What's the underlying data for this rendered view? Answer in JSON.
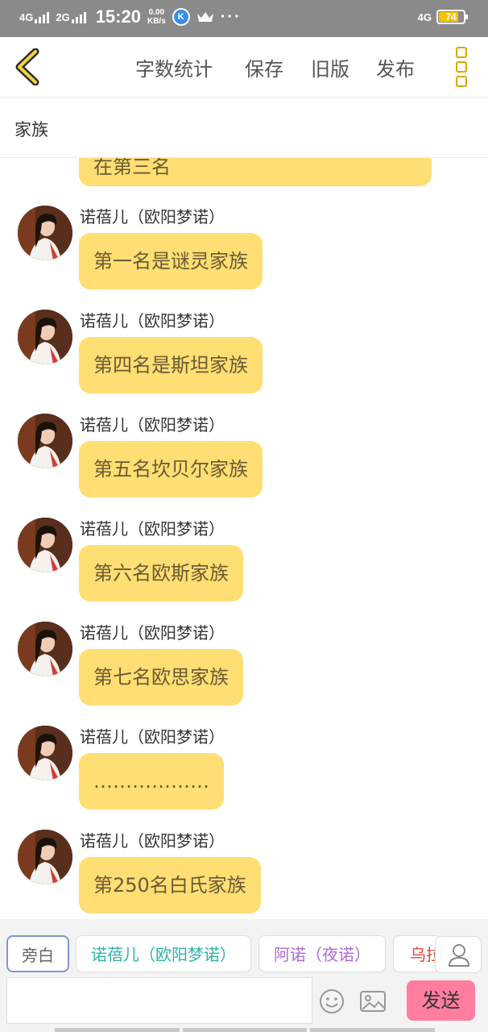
{
  "status_bar": {
    "signal_1": "4G",
    "signal_2": "2G",
    "time": "15:20",
    "speed_value": "0.00",
    "speed_unit": "KB/s",
    "k_icon": "K",
    "dots": "···",
    "network_right": "4G",
    "battery": "74"
  },
  "toolbar": {
    "word_count": "字数统计",
    "save": "保存",
    "old_version": "旧版",
    "publish": "发布"
  },
  "title": "家族",
  "partial_message": "在第三名",
  "messages": [
    {
      "sender": "诺蓓儿（欧阳梦诺）",
      "text": "第一名是谜灵家族"
    },
    {
      "sender": "诺蓓儿（欧阳梦诺）",
      "text": "第四名是斯坦家族"
    },
    {
      "sender": "诺蓓儿（欧阳梦诺）",
      "text": "第五名坎贝尔家族"
    },
    {
      "sender": "诺蓓儿（欧阳梦诺）",
      "text": "第六名欧斯家族"
    },
    {
      "sender": "诺蓓儿（欧阳梦诺）",
      "text": "第七名欧思家族"
    },
    {
      "sender": "诺蓓儿（欧阳梦诺）",
      "text": "………………"
    },
    {
      "sender": "诺蓓儿（欧阳梦诺）",
      "text": "第250名白氏家族"
    }
  ],
  "roles": [
    {
      "label": "旁白",
      "color": "#666666"
    },
    {
      "label": "诺蓓儿（欧阳梦诺）",
      "color": "#2bb5a9"
    },
    {
      "label": "阿诺（夜诺）",
      "color": "#b06ad6"
    },
    {
      "label": "乌拉",
      "color": "#e0483a"
    }
  ],
  "input": {
    "placeholder": ""
  },
  "send_label": "发送",
  "colors": {
    "bubble": "#ffde73",
    "accent": "#d9a800",
    "send": "#ff7ea0"
  }
}
